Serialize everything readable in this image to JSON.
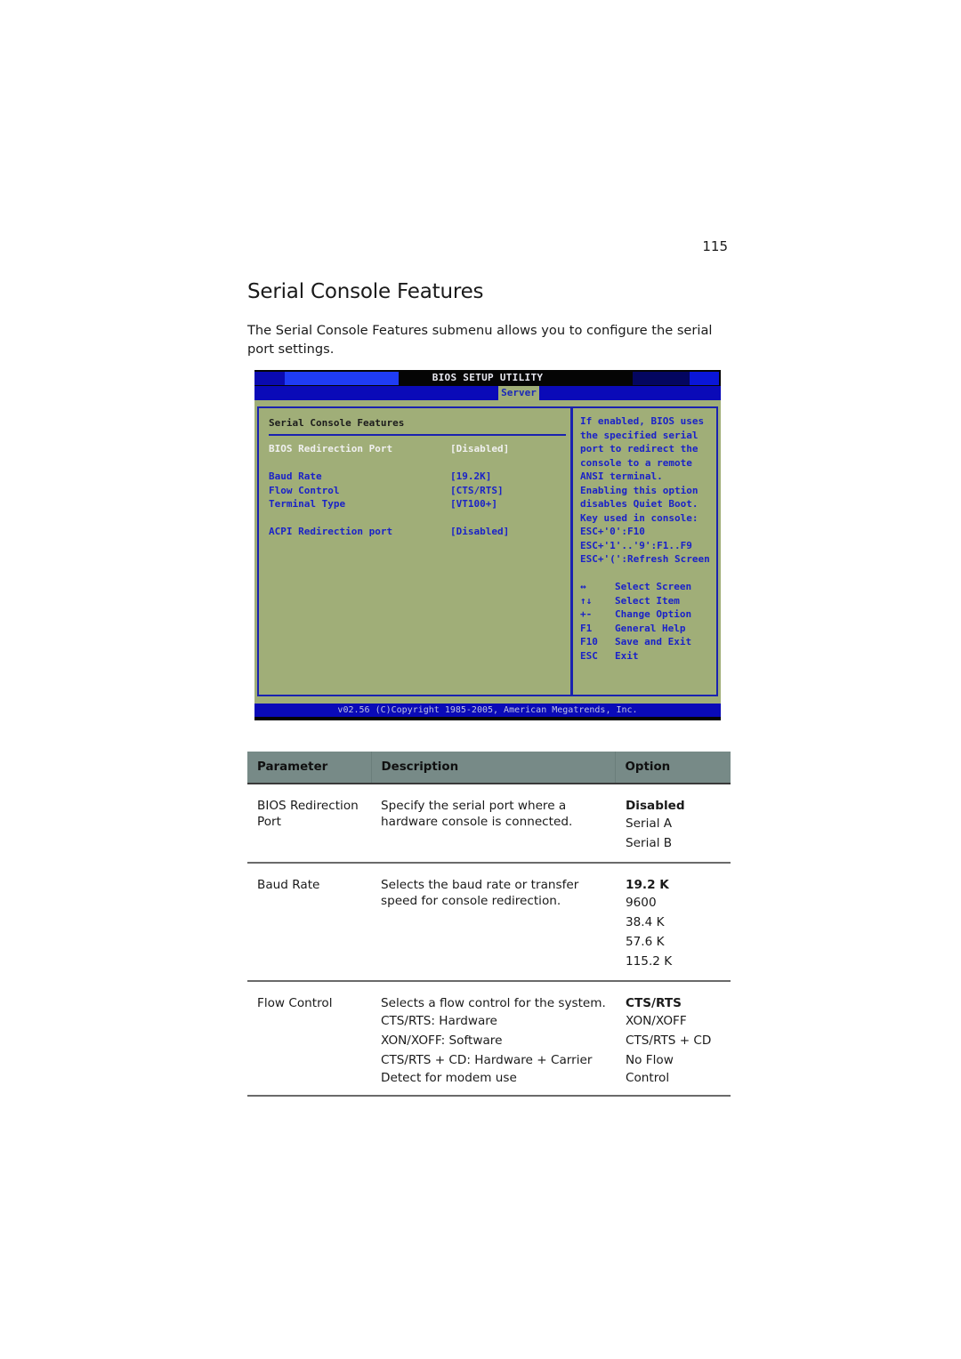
{
  "page": {
    "number": "115",
    "title": "Serial Console Features",
    "intro": "The Serial Console Features submenu allows you to configure the serial port settings."
  },
  "bios": {
    "title": "BIOS SETUP UTILITY",
    "active_tab": "Server",
    "submenu_title": "Serial Console Features",
    "settings": [
      {
        "label": "BIOS Redirection Port",
        "value": "[Disabled]",
        "selected": true
      },
      {
        "label": "Baud Rate",
        "value": "[19.2K]",
        "selected": false
      },
      {
        "label": "Flow Control",
        "value": "[CTS/RTS]",
        "selected": false
      },
      {
        "label": "Terminal Type",
        "value": "[VT100+]",
        "selected": false
      },
      {
        "label": "ACPI Redirection port",
        "value": "[Disabled]",
        "selected": false
      }
    ],
    "help_text": [
      "If enabled, BIOS uses",
      "the specified serial",
      "port to redirect the",
      "console to a remote",
      "ANSI terminal.",
      "Enabling this option",
      "disables Quiet Boot.",
      "Key used in console:",
      "ESC+'0':F10",
      "ESC+'1'..'9':F1..F9",
      "ESC+'(':Refresh Screen"
    ],
    "keys": [
      {
        "key": "↔",
        "icon": "left-right-arrow-icon",
        "action": "Select Screen"
      },
      {
        "key": "↑↓",
        "icon": "up-down-arrow-icon",
        "action": "Select Item"
      },
      {
        "key": "+-",
        "icon": "plus-minus-icon",
        "action": "Change Option"
      },
      {
        "key": "F1",
        "icon": "",
        "action": "General Help"
      },
      {
        "key": "F10",
        "icon": "",
        "action": "Save and Exit"
      },
      {
        "key": "ESC",
        "icon": "",
        "action": "Exit"
      }
    ],
    "footer": "v02.56 (C)Copyright 1985-2005, American Megatrends, Inc.",
    "colors": {
      "background": "#a0ae78",
      "accent_blue": "#0a0ab8",
      "text_blue": "#1a22c8",
      "selected_text": "#f0f0f0"
    }
  },
  "table": {
    "headers": {
      "parameter": "Parameter",
      "description": "Description",
      "option": "Option"
    },
    "header_color": "#778a87",
    "rows": [
      {
        "parameter": [
          "BIOS Redirection",
          "Port"
        ],
        "description": [
          "Specify the serial port where a",
          "hardware console is connected."
        ],
        "default_option": "Disabled",
        "options": [
          "Serial A",
          "Serial B"
        ]
      },
      {
        "parameter": [
          "Baud Rate"
        ],
        "description": [
          "Selects the baud rate or transfer",
          "speed for console redirection."
        ],
        "default_option": "19.2 K",
        "options": [
          "9600",
          "38.4 K",
          "57.6 K",
          "115.2 K"
        ]
      },
      {
        "parameter": [
          "Flow Control"
        ],
        "description": [
          "Selects a flow control for the system.",
          "CTS/RTS: Hardware",
          "XON/XOFF: Software",
          "CTS/RTS + CD: Hardware + Carrier",
          "Detect for modem use"
        ],
        "default_option": "CTS/RTS",
        "options": [
          "XON/XOFF",
          "CTS/RTS + CD",
          "No Flow",
          "Control"
        ]
      }
    ]
  }
}
